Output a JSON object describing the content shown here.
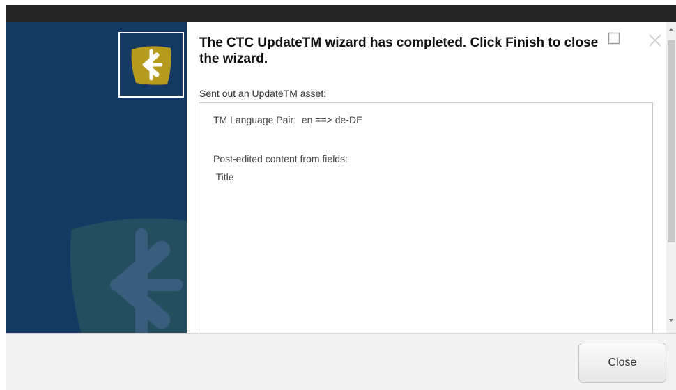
{
  "wizard": {
    "heading": "The CTC UpdateTM wizard has completed. Click Finish to close the wizard.",
    "sent_label": "Sent out an UpdateTM asset:",
    "details": {
      "language_pair": "TM Language Pair:  en ==> de-DE",
      "fields_label": "Post-edited content from fields:",
      "field_1": " Title"
    }
  },
  "footer": {
    "close_label": "Close"
  },
  "colors": {
    "sidebar_bg": "#143a64",
    "logo_gold": "#b59a1c",
    "titlebar_bg": "#252525",
    "footer_bg": "#f2f2f2"
  },
  "icons": {
    "logo": "ctc-logo-icon",
    "maximize": "maximize-icon",
    "close": "close-x-icon"
  }
}
